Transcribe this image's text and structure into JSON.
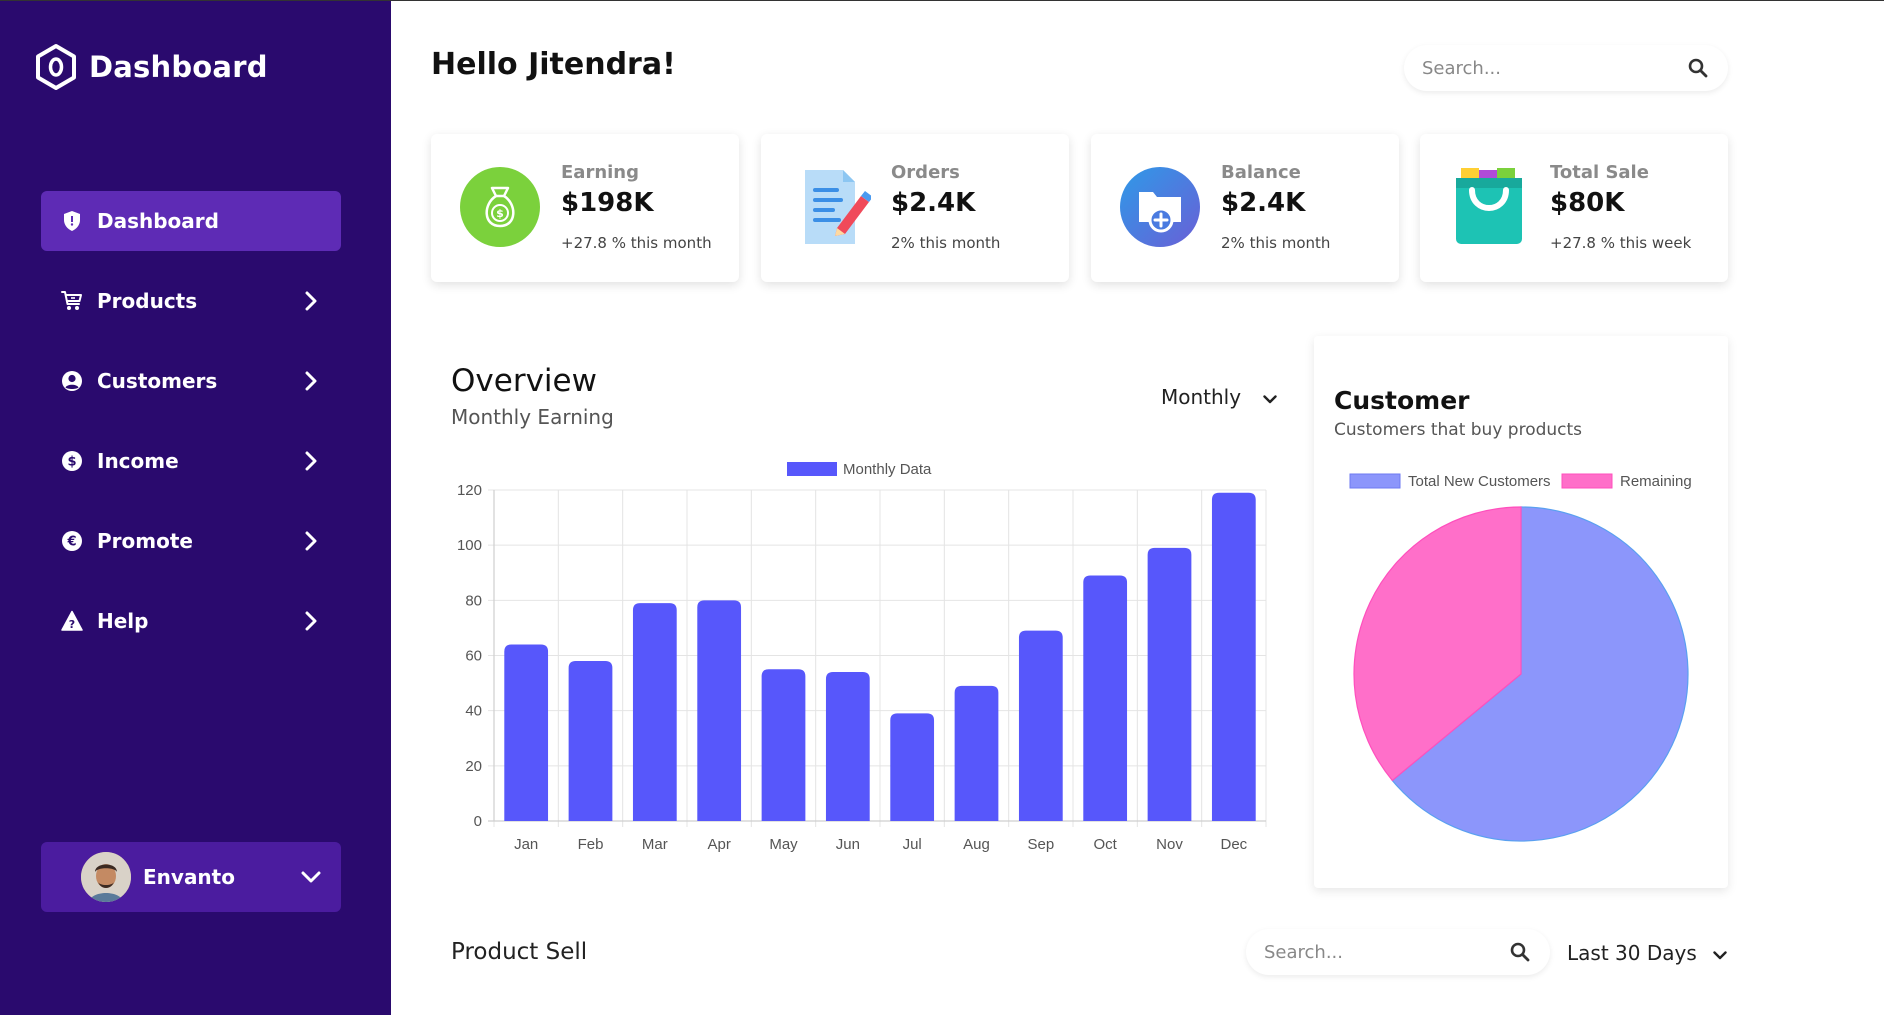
{
  "brand": {
    "title": "Dashboard",
    "icon": "hexagon-logo-icon"
  },
  "sidebar": {
    "items": [
      {
        "label": "Dashboard",
        "icon": "shield-icon",
        "active": true
      },
      {
        "label": "Products",
        "icon": "cart-icon"
      },
      {
        "label": "Customers",
        "icon": "user-circle-icon"
      },
      {
        "label": "Income",
        "icon": "dollar-circle-icon"
      },
      {
        "label": "Promote",
        "icon": "euro-circle-icon"
      },
      {
        "label": "Help",
        "icon": "warning-icon"
      }
    ],
    "user": {
      "name": "Envanto"
    }
  },
  "header": {
    "greeting": "Hello Jitendra!",
    "search_placeholder": "Search..."
  },
  "cards": [
    {
      "label": "Earning",
      "value": "$198K",
      "sub": "+27.8 % this month",
      "icon": "money-bag-icon",
      "color": "#7bd13c"
    },
    {
      "label": "Orders",
      "value": "$2.4K",
      "sub": "2% this month",
      "icon": "document-pencil-icon",
      "color": "#4aa3f0"
    },
    {
      "label": "Balance",
      "value": "$2.4K",
      "sub": "2% this month",
      "icon": "folder-plus-icon",
      "color": "#3a8ee8"
    },
    {
      "label": "Total Sale",
      "value": "$80K",
      "sub": "+27.8 % this week",
      "icon": "shopping-bag-icon",
      "color": "#1dc3b4"
    }
  ],
  "overview": {
    "title": "Overview",
    "subtitle": "Monthly Earning",
    "period": "Monthly"
  },
  "customer": {
    "title": "Customer",
    "subtitle": "Customers that buy products"
  },
  "product_sell": {
    "title": "Product Sell",
    "search_placeholder": "Search...",
    "range": "Last 30 Days"
  },
  "chart_data": [
    {
      "type": "bar",
      "title": "",
      "categories": [
        "Jan",
        "Feb",
        "Mar",
        "Apr",
        "May",
        "Jun",
        "Jul",
        "Aug",
        "Sep",
        "Oct",
        "Nov",
        "Dec"
      ],
      "series": [
        {
          "name": "Monthly Data",
          "values": [
            64,
            58,
            79,
            80,
            55,
            54,
            39,
            49,
            69,
            89,
            99,
            119
          ],
          "color": "#5757fb"
        }
      ],
      "ylim": [
        0,
        120
      ],
      "yticks": [
        0,
        20,
        40,
        60,
        80,
        100,
        120
      ],
      "grid": true,
      "legend": "top-center"
    },
    {
      "type": "pie",
      "labels": [
        "Total New Customers",
        "Remaining"
      ],
      "values": [
        64,
        36
      ],
      "colors": [
        "#8c96fb",
        "#ff6fc9"
      ],
      "legend": "top"
    }
  ]
}
